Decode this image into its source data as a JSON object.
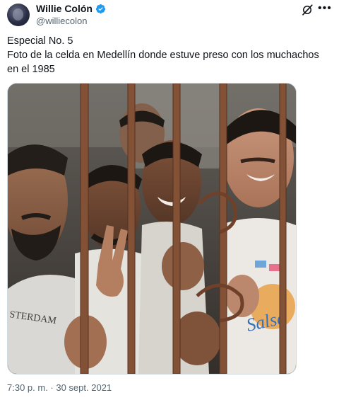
{
  "author": {
    "display_name": "Willie Colón",
    "handle": "@williecolon",
    "verified": true
  },
  "icons": {
    "verified": "verified-badge-icon",
    "grok": "grok-icon",
    "more": "more-options-icon"
  },
  "tweet": {
    "line1": "Especial No. 5",
    "line2": "Foto de la celda en Medellín donde estuve preso con los muchachos en el 1985",
    "timestamp": "7:30 p. m. · 30 sept. 2021"
  },
  "colors": {
    "verified_blue": "#1d9bf0",
    "text_primary": "#0f1419",
    "text_secondary": "#536471",
    "border": "#cfd9de"
  }
}
